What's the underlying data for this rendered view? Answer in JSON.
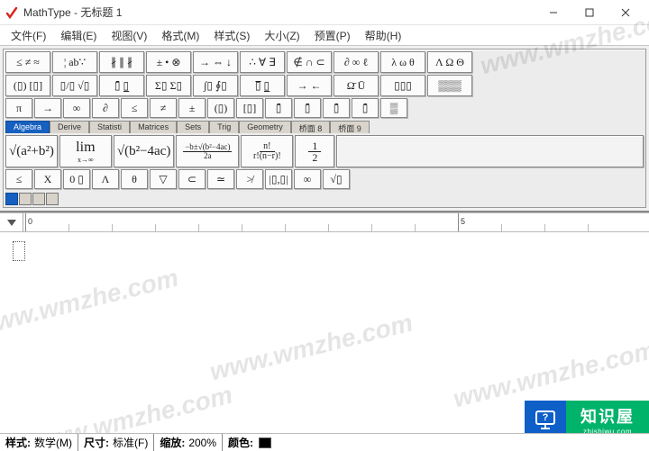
{
  "window": {
    "app_name": "MathType",
    "doc_title": "无标题 1",
    "title_sep": " - "
  },
  "menu": {
    "file": "文件(F)",
    "edit": "编辑(E)",
    "view": "视图(V)",
    "format": "格式(M)",
    "style": "样式(S)",
    "size": "大小(Z)",
    "prefs": "预置(P)",
    "help": "帮助(H)"
  },
  "palette": {
    "row1": [
      "≤ ≠ ≈",
      "¦ ab∵",
      "∦ ∥ ∦",
      "± • ⊗",
      "→ ⇔ ↓",
      "∴ ∀ ∃",
      "∉ ∩ ⊂",
      "∂ ∞ ℓ",
      "λ ω θ",
      "Λ Ω Θ"
    ],
    "row2": [
      "(▯) [▯]",
      "▯/▯ √▯",
      "▯̄ ▯̲",
      "Σ▯ Σ▯",
      "∫▯ ∮▯",
      "▯̅ ▯̲",
      "→ ←",
      "Ω̄ Ū",
      "▯▯▯",
      "▒▒▒"
    ],
    "row3": [
      "π",
      "→",
      "∞",
      "∂",
      "≤",
      "≠",
      "±",
      "(▯)",
      "[▯]",
      "▯̄",
      "▯̄",
      "▯̄",
      "▯̄",
      "▒"
    ],
    "tabs": [
      "Algebra",
      "Derive",
      "Statisti",
      "Matrices",
      "Sets",
      "Trig",
      "Geometry",
      "桥面 8",
      "桥面 9"
    ],
    "active_tab_index": 0,
    "row4_math": [
      "\\sqrt{a^{2}+b^{2}}",
      "\\lim_{x\\to\\infty}",
      "\\sqrt{b^{2}-4ac}",
      "\\frac{-b\\pm\\sqrt{b^{2}-4ac}}{2a}",
      "\\frac{n!}{r!(n-r)!}",
      "\\frac{1}{2}"
    ],
    "row5": [
      "≤",
      "X",
      "0 ▯",
      "Λ",
      "θ",
      "▽",
      "⊂",
      "≃",
      "≯",
      "|▯,▯|",
      "∞",
      "√▯"
    ]
  },
  "ruler": {
    "label": "0",
    "major": "5"
  },
  "status": {
    "style_label": "样式:",
    "style_value": "数学(M)",
    "size_label": "尺寸:",
    "size_value": "标准(F)",
    "zoom_label": "缩放:",
    "zoom_value": "200%",
    "color_label": "颜色:"
  },
  "watermarks": [
    "www.wmzhe.com",
    "www.wmzhe.com",
    "www.wmzhe.com",
    "www.wmzhe.com",
    "www.wmzhe.com"
  ],
  "brand": {
    "name": "知识屋",
    "url": "zhishiwu.com"
  }
}
